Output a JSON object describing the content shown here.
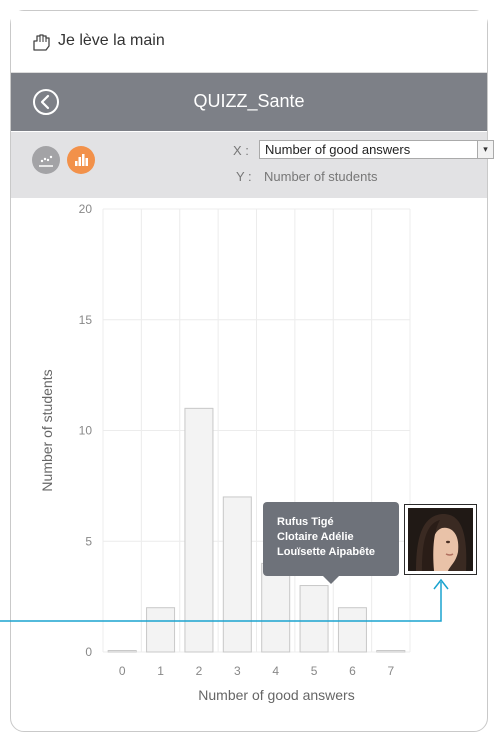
{
  "app": {
    "name": "Je lève la main"
  },
  "header": {
    "title": "QUIZZ_Sante"
  },
  "toolbar": {
    "x_prefix": "X :",
    "y_prefix": "Y :",
    "x_select_value": "Number of good answers",
    "y_value": "Number of students"
  },
  "tooltip": {
    "names": [
      "Rufus Tigé",
      "Clotaire Adélie",
      "Louïsette Aipabête"
    ]
  },
  "colors": {
    "titlebar": "#7d8087",
    "toolbar": "#e2e2e4",
    "accent_orange": "#f2914a",
    "connector": "#1aa3cf",
    "bar_fill": "#f3f3f3"
  },
  "icons": {
    "app": "raised-hand-icon",
    "back": "back-chevron-icon",
    "chart_scatter": "scatter-chart-icon",
    "chart_bar": "bar-chart-icon"
  },
  "chart_data": {
    "type": "bar",
    "categories": [
      "0",
      "1",
      "2",
      "3",
      "4",
      "5",
      "6",
      "7"
    ],
    "values": [
      0,
      2,
      11,
      7,
      4,
      3,
      2,
      0
    ],
    "xlabel": "Number of good answers",
    "ylabel": "Number of students",
    "ylim": [
      0,
      20
    ],
    "yticks": [
      0,
      5,
      10,
      15,
      20
    ],
    "grid": true,
    "highlighted_category": "5"
  }
}
